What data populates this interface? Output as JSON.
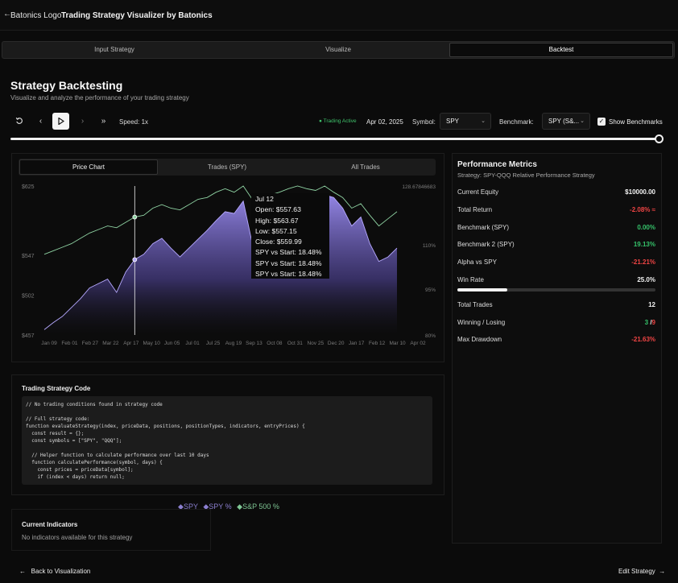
{
  "header": {
    "back_icon": "arrow-left-icon",
    "logo_text": "Batonics Logo",
    "title": "Trading Strategy Visualizer by Batonics"
  },
  "tabs": [
    {
      "label": "Input Strategy",
      "active": false
    },
    {
      "label": "Visualize",
      "active": false
    },
    {
      "label": "Backtest",
      "active": true
    }
  ],
  "page": {
    "title": "Strategy Backtesting",
    "subtitle": "Visualize and analyze the performance of your trading strategy"
  },
  "controls": {
    "reset_icon": "rotate-ccw-icon",
    "prev_icon": "chevron-left-icon",
    "play_icon": "play-icon",
    "next_icon": "chevron-right-icon",
    "ffwd_icon": "fast-forward-icon",
    "speed": "Speed: 1x",
    "status": "Trading Active",
    "date": "Apr 02, 2025",
    "symbol_label": "Symbol:",
    "symbol_value": "SPY",
    "benchmark_label": "Benchmark:",
    "benchmark_value": "SPY (S&...",
    "show_benchmarks_label": "Show Benchmarks",
    "show_benchmarks_checked": true,
    "timeline_progress": 1.0
  },
  "chart_tabs": [
    {
      "label": "Price Chart",
      "active": true
    },
    {
      "label": "Trades (SPY)",
      "active": false
    },
    {
      "label": "All Trades",
      "active": false
    }
  ],
  "tooltip": {
    "date": "Jul 12",
    "open": "Open: $557.63",
    "high": "High: $563.67",
    "low": "Low: $557.15",
    "close": "Close: $559.99",
    "r1": "SPY vs Start: 18.48%",
    "r2": "SPY vs Start: 18.48%",
    "r3": "SPY vs Start: 18.48%"
  },
  "chart_data": {
    "type": "area",
    "x_ticks": [
      "Jan 09",
      "Feb 01",
      "Feb 27",
      "Mar 22",
      "Apr 17",
      "May 10",
      "Jun 05",
      "Jul 01",
      "Jul 25",
      "Aug 19",
      "Sep 13",
      "Oct 08",
      "Oct 31",
      "Nov 25",
      "Dec 20",
      "Jan 17",
      "Feb 12",
      "Mar 10",
      "Apr 02"
    ],
    "y_left_ticks": [
      "$625",
      "$547",
      "$502",
      "$457"
    ],
    "y_right_ticks": [
      "128.67846683",
      "110%",
      "95%",
      "80%"
    ],
    "ylim_left": [
      457,
      625
    ],
    "legend": [
      {
        "name": "SPY",
        "color": "#8b7fd0",
        "icon": "diamond-icon"
      },
      {
        "name": "SPY %",
        "color": "#8b7fd0",
        "icon": "diamond-icon"
      },
      {
        "name": "S&P 500 %",
        "color": "#7fc795",
        "icon": "diamond-icon"
      }
    ],
    "series": [
      {
        "name": "SPY",
        "values": [
          463,
          471,
          478,
          488,
          498,
          510,
          515,
          520,
          505,
          528,
          542,
          548,
          560,
          566,
          555,
          545,
          555,
          565,
          575,
          586,
          596,
          594,
          608,
          560,
          545,
          578,
          582,
          590,
          600,
          598,
          605,
          615,
          612,
          600,
          580,
          590,
          560,
          540,
          545,
          555
        ]
      },
      {
        "name": "S&P 500 %",
        "values": [
          548,
          552,
          556,
          560,
          566,
          572,
          576,
          580,
          578,
          584,
          590,
          592,
          600,
          604,
          600,
          598,
          604,
          610,
          612,
          618,
          622,
          618,
          625,
          610,
          605,
          615,
          618,
          622,
          625,
          622,
          620,
          625,
          618,
          612,
          600,
          605,
          592,
          580,
          588,
          596
        ]
      }
    ],
    "cursor_x_index": 10
  },
  "metrics": {
    "title": "Performance Metrics",
    "strategy": "Strategy: SPY-QQQ Relative Performance Strategy",
    "rows": [
      {
        "label": "Current Equity",
        "value": "$10000.00",
        "tone": "neu"
      },
      {
        "label": "Total Return",
        "value": "-2.08% ≈",
        "tone": "neg"
      },
      {
        "label": "Benchmark (SPY)",
        "value": "0.00%",
        "tone": "pos"
      },
      {
        "label": "Benchmark 2 (SPY)",
        "value": "19.13%",
        "tone": "pos"
      },
      {
        "label": "Alpha vs SPY",
        "value": "-21.21%",
        "tone": "neg"
      },
      {
        "label": "Win Rate",
        "value": "25.0%",
        "tone": "neu"
      },
      {
        "label": "Total Trades",
        "value": "12",
        "tone": "neu"
      },
      {
        "label": "Winning / Losing",
        "value_win": "3",
        "value_sep": " /",
        "value_lose": "9"
      },
      {
        "label": "Max Drawdown",
        "value": "-21.63%",
        "tone": "neg"
      }
    ],
    "win_rate_fraction": 0.25
  },
  "code": {
    "title": "Trading Strategy Code",
    "lines": [
      "// No trading conditions found in strategy code",
      "",
      "// Full strategy code:",
      "function evaluateStrategy(index, priceData, positions, positionTypes, indicators, entryPrices) {",
      "  const result = {};",
      "  const symbols = [\"SPY\", \"QQQ\"];",
      "",
      "  // Helper function to calculate performance over last 10 days",
      "  function calculatePerformance(symbol, days) {",
      "    const prices = priceData[symbol];",
      "    if (index < days) return null;"
    ]
  },
  "indicators": {
    "title": "Current Indicators",
    "empty": "No indicators available for this strategy"
  },
  "footer": {
    "back_label": "Back to Visualization",
    "back_icon": "arrow-left-icon",
    "edit_label": "Edit Strategy",
    "edit_icon": "arrow-right-icon"
  }
}
